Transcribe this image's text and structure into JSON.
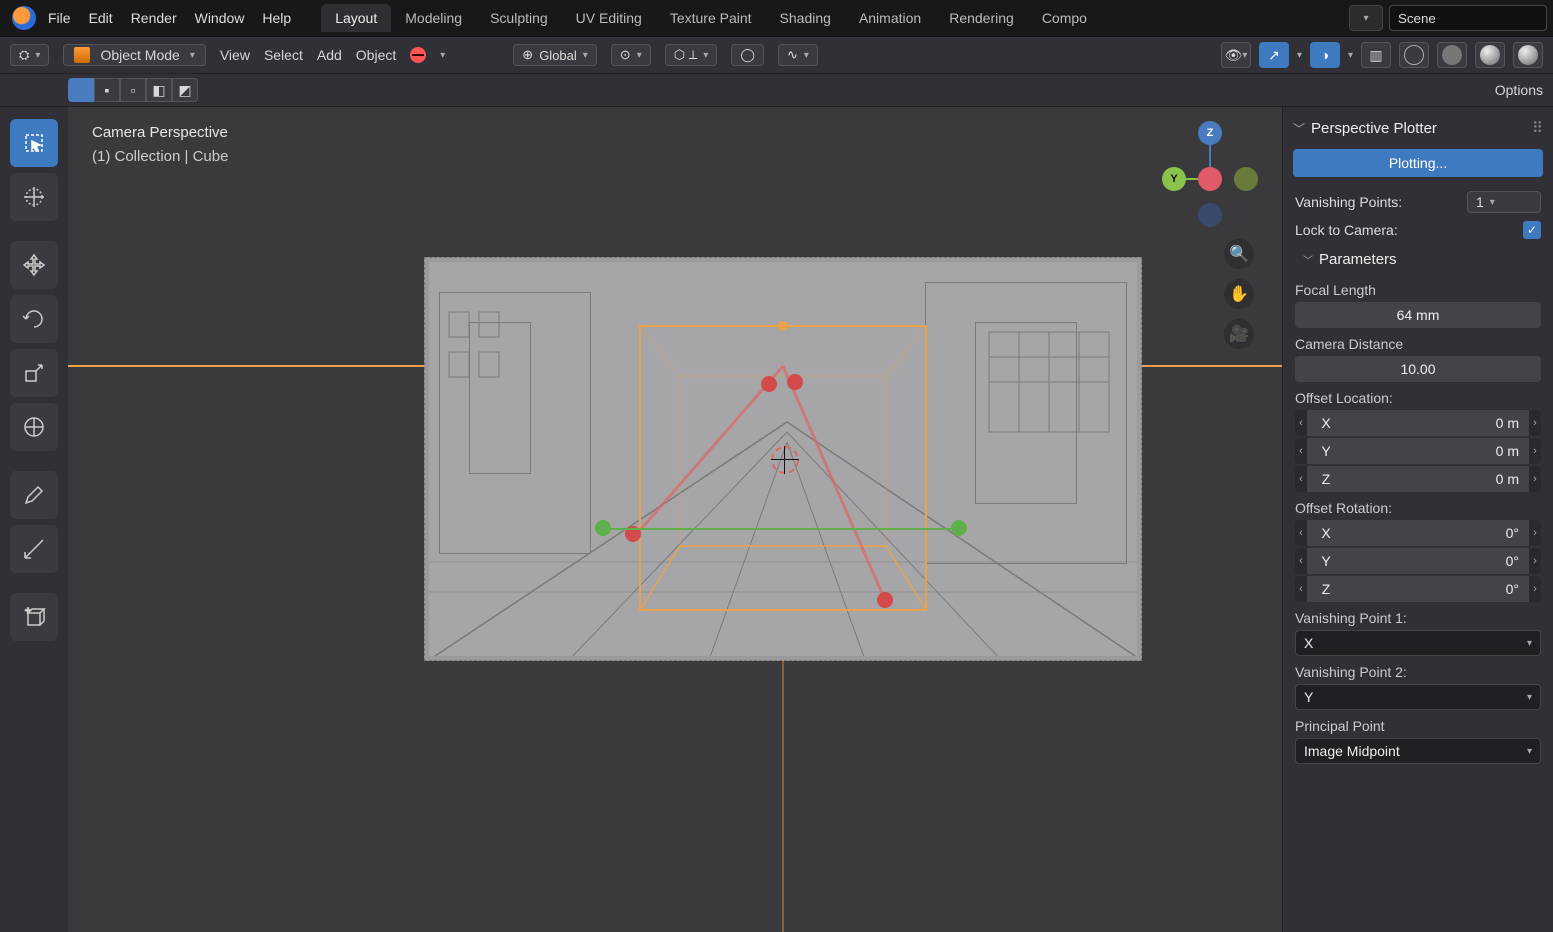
{
  "menu": {
    "file": "File",
    "edit": "Edit",
    "render": "Render",
    "window": "Window",
    "help": "Help"
  },
  "tabs": [
    "Layout",
    "Modeling",
    "Sculpting",
    "UV Editing",
    "Texture Paint",
    "Shading",
    "Animation",
    "Rendering",
    "Compo"
  ],
  "active_tab": 0,
  "scene": "Scene",
  "mode": "Object Mode",
  "header2": {
    "view": "View",
    "select": "Select",
    "add": "Add",
    "object": "Object",
    "global": "Global"
  },
  "options": "Options",
  "hud": {
    "line1": "Camera Perspective",
    "line2": "(1) Collection | Cube"
  },
  "gizmo": {
    "z": "Z",
    "y": "Y",
    "x": ""
  },
  "panel": {
    "title": "Perspective Plotter",
    "plotting": "Plotting...",
    "vp_label": "Vanishing Points:",
    "vp_value": "1",
    "lock_label": "Lock to Camera:",
    "params": "Parameters",
    "focal_label": "Focal Length",
    "focal_value": "64 mm",
    "dist_label": "Camera Distance",
    "dist_value": "10.00",
    "offloc_label": "Offset Location:",
    "loc": {
      "x": "X",
      "y": "Y",
      "z": "Z",
      "xv": "0 m",
      "yv": "0 m",
      "zv": "0 m"
    },
    "offrot_label": "Offset Rotation:",
    "rot": {
      "x": "X",
      "y": "Y",
      "z": "Z",
      "xv": "0°",
      "yv": "0°",
      "zv": "0°"
    },
    "vp1_label": "Vanishing Point 1:",
    "vp1_value": "X",
    "vp2_label": "Vanishing Point 2:",
    "vp2_value": "Y",
    "pp_label": "Principal Point",
    "pp_value": "Image Midpoint"
  }
}
